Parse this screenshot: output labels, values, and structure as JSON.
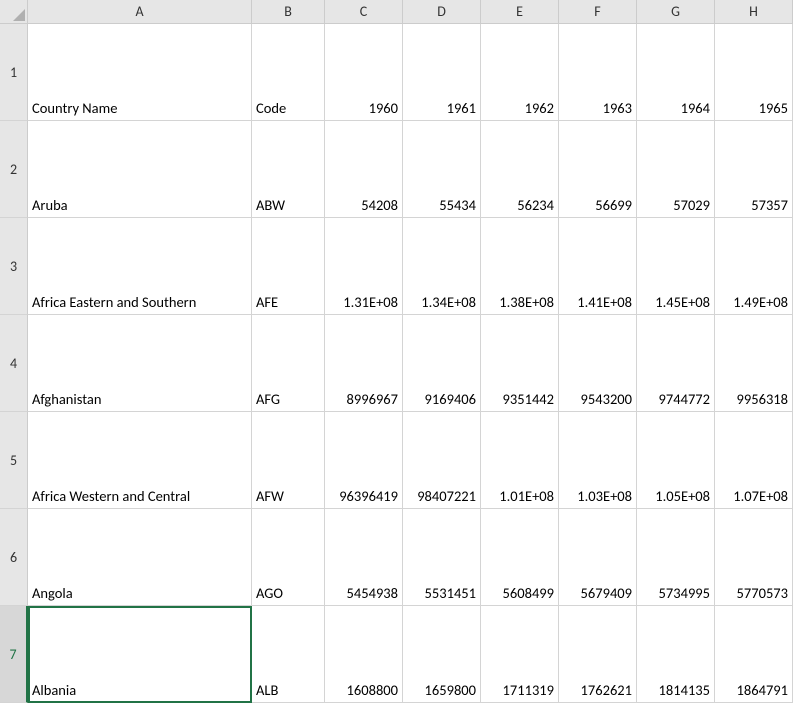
{
  "columns": [
    "A",
    "B",
    "C",
    "D",
    "E",
    "F",
    "G",
    "H"
  ],
  "row_numbers": [
    "1",
    "2",
    "3",
    "4",
    "5",
    "6",
    "7"
  ],
  "active_cell_row": "7",
  "header": {
    "country": "Country Name",
    "code": "Code",
    "years": [
      "1960",
      "1961",
      "1962",
      "1963",
      "1964",
      "1965"
    ]
  },
  "rows": [
    {
      "country": "Aruba",
      "code": "ABW",
      "values": [
        "54208",
        "55434",
        "56234",
        "56699",
        "57029",
        "57357"
      ]
    },
    {
      "country": "Africa Eastern and Southern",
      "code": "AFE",
      "values": [
        "1.31E+08",
        "1.34E+08",
        "1.38E+08",
        "1.41E+08",
        "1.45E+08",
        "1.49E+08"
      ]
    },
    {
      "country": "Afghanistan",
      "code": "AFG",
      "values": [
        "8996967",
        "9169406",
        "9351442",
        "9543200",
        "9744772",
        "9956318"
      ]
    },
    {
      "country": "Africa Western and Central",
      "code": "AFW",
      "values": [
        "96396419",
        "98407221",
        "1.01E+08",
        "1.03E+08",
        "1.05E+08",
        "1.07E+08"
      ]
    },
    {
      "country": "Angola",
      "code": "AGO",
      "values": [
        "5454938",
        "5531451",
        "5608499",
        "5679409",
        "5734995",
        "5770573"
      ]
    },
    {
      "country": "Albania",
      "code": "ALB",
      "values": [
        "1608800",
        "1659800",
        "1711319",
        "1762621",
        "1814135",
        "1864791"
      ]
    }
  ]
}
